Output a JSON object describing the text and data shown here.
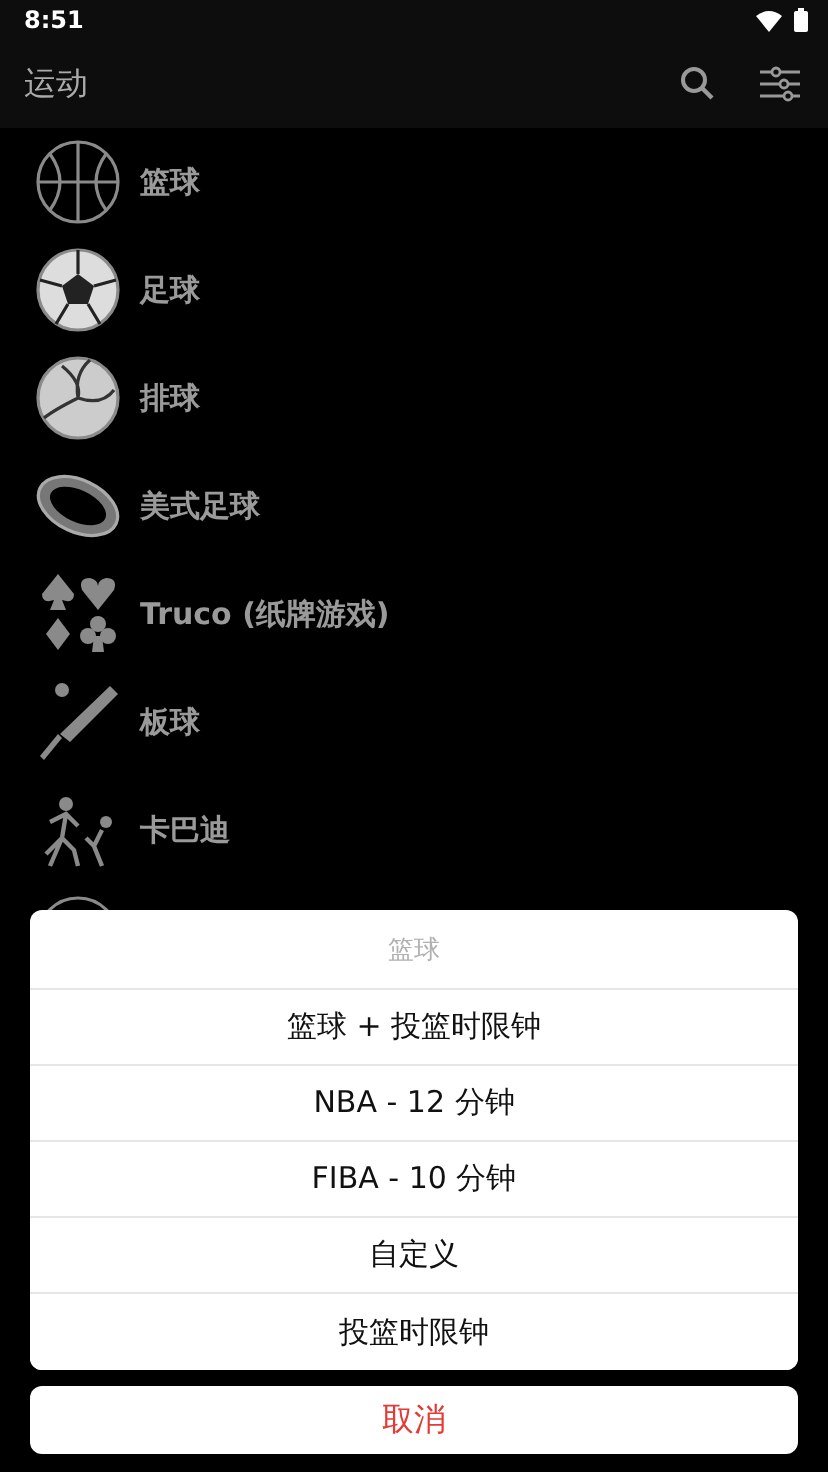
{
  "status_bar": {
    "time": "8:51"
  },
  "app_bar": {
    "title": "运动"
  },
  "sports": [
    {
      "name": "篮球",
      "kind": "basketball"
    },
    {
      "name": "足球",
      "kind": "soccer"
    },
    {
      "name": "排球",
      "kind": "volleyball"
    },
    {
      "name": "美式足球",
      "kind": "football"
    },
    {
      "name": "Truco (纸牌游戏)",
      "kind": "cards"
    },
    {
      "name": "板球",
      "kind": "cricket"
    },
    {
      "name": "卡巴迪",
      "kind": "kabaddi"
    },
    {
      "kind": "ball-partial"
    }
  ],
  "action_sheet": {
    "title": "篮球",
    "options": [
      "篮球 + 投篮时限钟",
      "NBA - 12 分钟",
      "FIBA - 10 分钟",
      "自定义",
      "投篮时限钟"
    ],
    "cancel": "取消"
  }
}
